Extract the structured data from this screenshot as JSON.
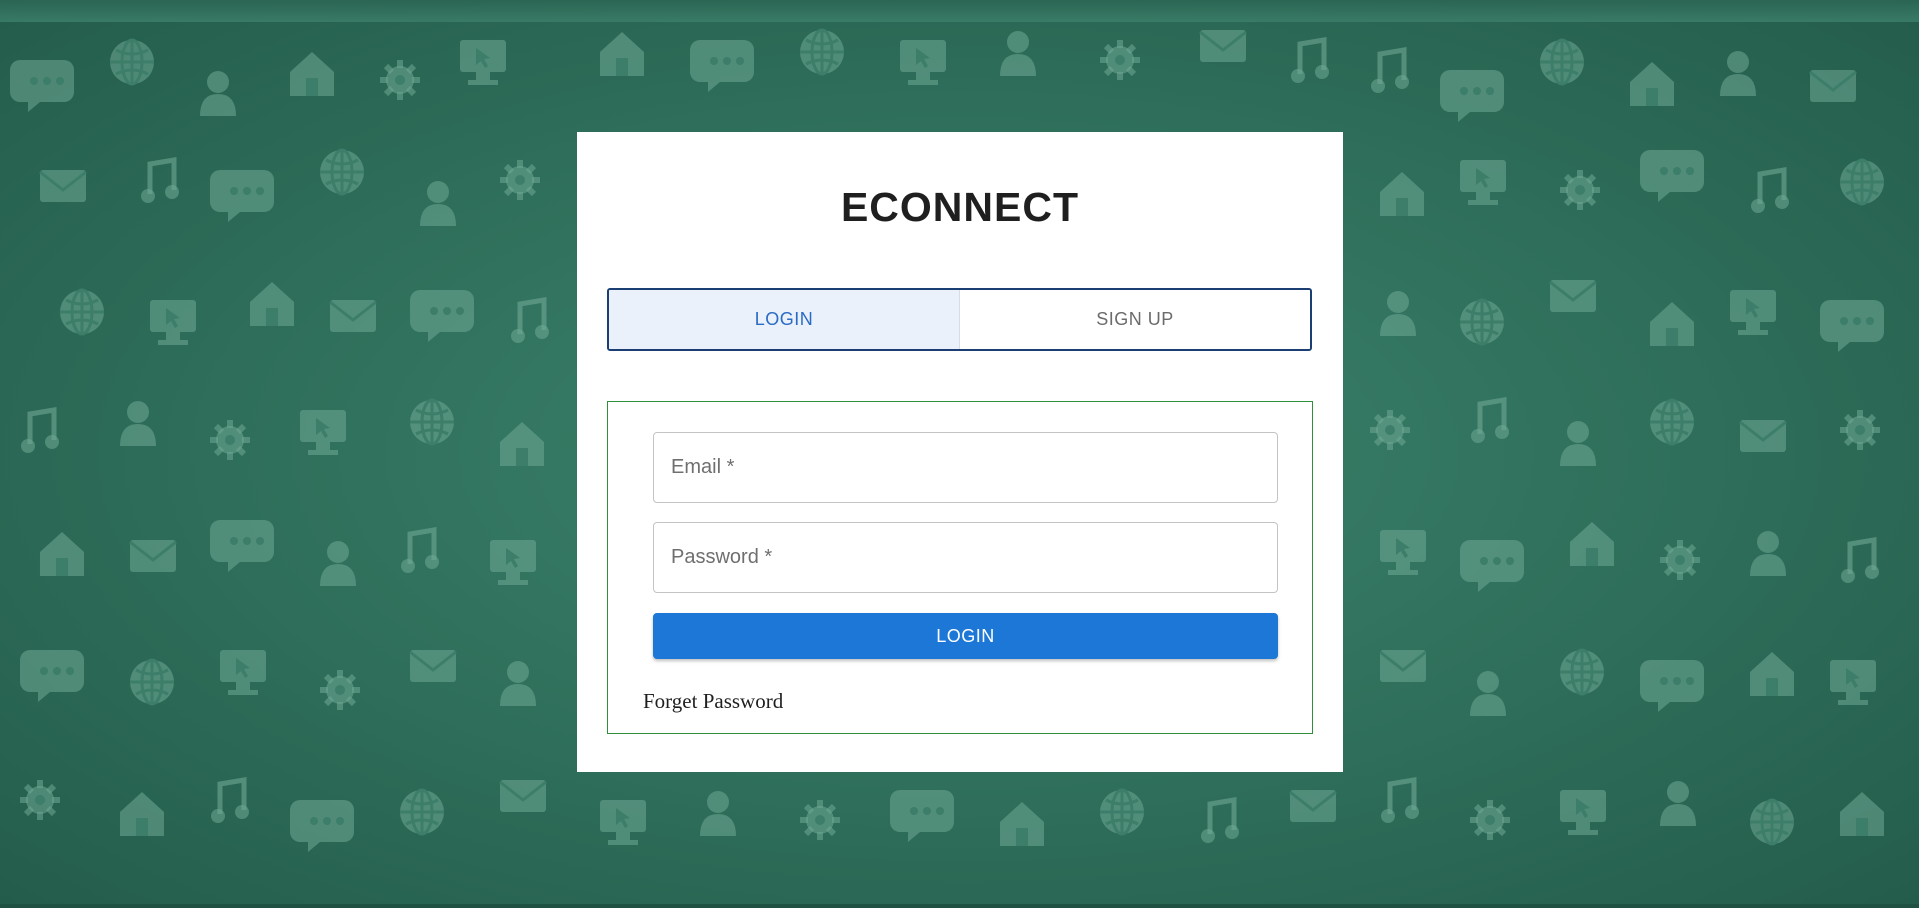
{
  "app": {
    "title": "ECONNECT"
  },
  "tabs": [
    {
      "label": "LOGIN",
      "active": true
    },
    {
      "label": "SIGN UP",
      "active": false
    }
  ],
  "form": {
    "email_placeholder": "Email *",
    "email_value": "",
    "password_placeholder": "Password *",
    "password_value": "",
    "submit_label": "LOGIN",
    "forget_password_label": "Forget Password"
  },
  "colors": {
    "background": "#2f6f5c",
    "tab_active_bg": "#eaf1fa",
    "tab_active_text": "#2a6bc4",
    "tab_border": "#1c3f73",
    "form_border": "#2f8f3a",
    "primary_button": "#1c77d6"
  },
  "background": {
    "pattern": "social-media-icon-doodle-pattern"
  }
}
